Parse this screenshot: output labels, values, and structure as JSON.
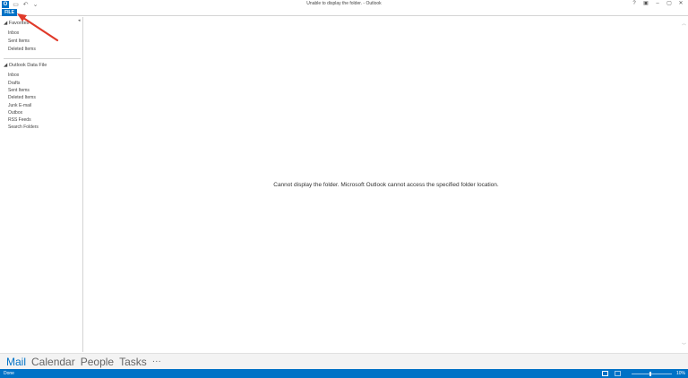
{
  "window": {
    "title": "Unable to display the folder. - Outlook",
    "app_icon_letter": "O",
    "undo_glyph": "↶",
    "qat_more_glyph": "⌄",
    "save_glyph": "▭",
    "controls": [
      "?",
      "▣",
      "–",
      "▢",
      "✕"
    ]
  },
  "ribbon": {
    "file_tab": "FILE"
  },
  "folder_pane": {
    "collapse_glyph": "◂",
    "favorites": {
      "header": "◢ Favorites",
      "items": [
        "Inbox",
        "Sent Items",
        "Deleted Items"
      ]
    },
    "data_file": {
      "header": "◢ Outlook Data File",
      "items": [
        "Inbox",
        "Drafts",
        "Sent Items",
        "Deleted Items",
        "Junk E-mail",
        "Outbox",
        "RSS Feeds",
        "Search Folders"
      ]
    }
  },
  "main": {
    "message": "Cannot display the folder. Microsoft Outlook cannot access the specified folder location.",
    "scroll_up_glyph": "︿",
    "scroll_down_glyph": "﹀"
  },
  "navigation": {
    "items": [
      "Mail",
      "Calendar",
      "People",
      "Tasks"
    ],
    "more": "···"
  },
  "status": {
    "text": "Done",
    "zoom": "10%"
  },
  "colors": {
    "accent": "#0072c6",
    "annotation_arrow": "#e03a2a"
  }
}
